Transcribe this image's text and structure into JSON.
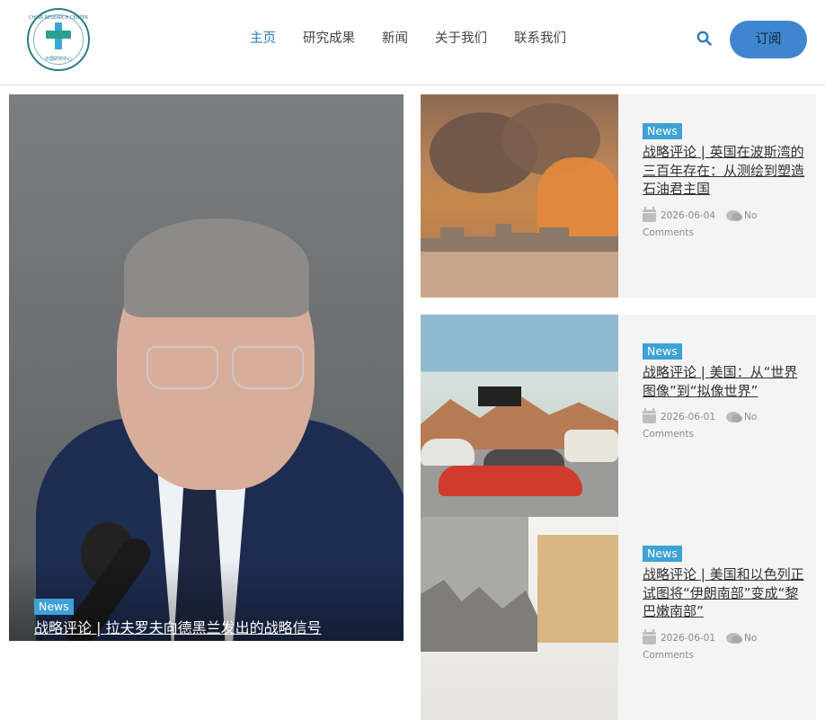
{
  "header": {
    "logo": {
      "name": "Logo",
      "arc_top": "CHINA RESEARCH CENTER",
      "arc_bottom": "中国研究中心"
    },
    "nav": [
      {
        "label": "主页",
        "active": true
      },
      {
        "label": "研究成果",
        "active": false
      },
      {
        "label": "新闻",
        "active": false
      },
      {
        "label": "关于我们",
        "active": false
      },
      {
        "label": "联系我们",
        "active": false
      }
    ],
    "search_icon": "search-icon",
    "subscribe_label": "订阅",
    "accent_color": "#3f86cf"
  },
  "featured": {
    "badge": "News",
    "title": "战略评论 | 拉夫罗夫向德黑兰发出的战略信号"
  },
  "articles": [
    {
      "badge": "News",
      "title": "战略评论 | 英国在波斯湾的三百年存在：从测绘到塑造石油君主国",
      "date": "2026-06-04",
      "comments": "No Comments"
    },
    {
      "badge": "News",
      "title": "战略评论 | 美国：从“世界图像”到“拟像世界”",
      "date": "2026-06-01",
      "comments": "No Comments"
    },
    {
      "badge": "News",
      "title": "战略评论 | 美国和以色列正试图将“伊朗南部”变成“黎巴嫩南部”",
      "date": "2026-06-01",
      "comments": "No Comments"
    }
  ],
  "badge_color": "#3ea2d6"
}
